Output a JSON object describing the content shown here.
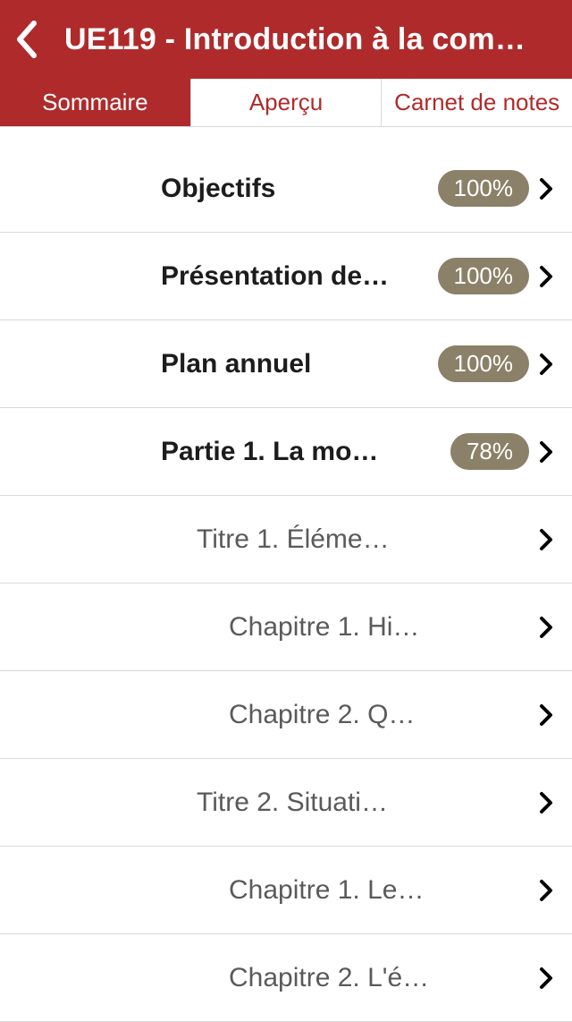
{
  "header": {
    "title": "UE119 - Introduction à la com…"
  },
  "tabs": [
    {
      "label": "Sommaire",
      "active": true
    },
    {
      "label": "Aperçu",
      "active": false
    },
    {
      "label": "Carnet de notes",
      "active": false
    }
  ],
  "rows": [
    {
      "label": "Objectifs",
      "bold": true,
      "indent": 0,
      "badge": "100%"
    },
    {
      "label": "Présentation de…",
      "bold": true,
      "indent": 0,
      "badge": "100%"
    },
    {
      "label": "Plan annuel",
      "bold": true,
      "indent": 0,
      "badge": "100%"
    },
    {
      "label": "Partie 1. La mo…",
      "bold": true,
      "indent": 0,
      "badge": "78%"
    },
    {
      "label": "Titre 1. Éléme…",
      "bold": false,
      "indent": 1,
      "badge": null
    },
    {
      "label": "Chapitre 1. Hi…",
      "bold": false,
      "indent": 2,
      "badge": null
    },
    {
      "label": "Chapitre 2. Q…",
      "bold": false,
      "indent": 2,
      "badge": null
    },
    {
      "label": "Titre 2. Situati…",
      "bold": false,
      "indent": 1,
      "badge": null
    },
    {
      "label": "Chapitre 1. Le…",
      "bold": false,
      "indent": 2,
      "badge": null
    },
    {
      "label": "Chapitre 2. L'é…",
      "bold": false,
      "indent": 2,
      "badge": null
    }
  ]
}
